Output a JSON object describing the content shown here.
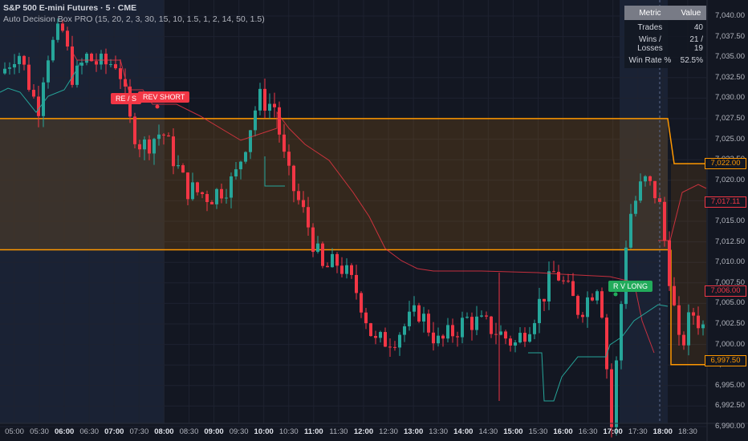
{
  "header": {
    "title": "S&P 500 E-mini Futures · 5 · CME",
    "indicator": "Auto Decision Box PRO (15, 20, 2, 3, 30, 15, 10, 1.5, 1, 2, 14, 50, 1.5)"
  },
  "colors": {
    "background": "#131722",
    "up": "#26a69a",
    "down": "#f23645",
    "box_line": "#ff9800",
    "trail_short": "#f23645",
    "trail_long": "#26a69a",
    "session_shade": "#1a2234"
  },
  "stats_table": {
    "headers": [
      "Metric",
      "Value"
    ],
    "rows": [
      {
        "metric": "Trades",
        "value": "40"
      },
      {
        "metric": "Wins / Losses",
        "value": "21 / 19"
      },
      {
        "metric": "Win Rate %",
        "value": "52.5%"
      }
    ]
  },
  "signals": [
    {
      "label": "RE / S",
      "type": "short"
    },
    {
      "label": "REV SHORT",
      "type": "short"
    },
    {
      "label": "R  V LONG",
      "type": "long"
    }
  ],
  "price_axis": {
    "ticks": [
      "7,040.00",
      "7,037.50",
      "7,035.00",
      "7,032.50",
      "7,030.00",
      "7,027.50",
      "7,025.00",
      "7,022.50",
      "7,020.00",
      "7,017.50",
      "7,015.00",
      "7,012.50",
      "7,010.00",
      "7,007.50",
      "7,005.00",
      "7,002.50",
      "7,000.00",
      "6,997.50",
      "6,995.00",
      "6,992.50",
      "6,990.00"
    ],
    "badges": [
      {
        "label": "7,022.00",
        "color": "#ff9800"
      },
      {
        "label": "7,017.11",
        "color": "#f23645"
      },
      {
        "label": "7,006.00",
        "color": "#f23645"
      },
      {
        "label": "6,997.50",
        "color": "#ff9800"
      }
    ]
  },
  "time_axis": {
    "ticks": [
      {
        "label": "05:00",
        "bold": false
      },
      {
        "label": "05:30",
        "bold": false
      },
      {
        "label": "06:00",
        "bold": true
      },
      {
        "label": "06:30",
        "bold": false
      },
      {
        "label": "07:00",
        "bold": true
      },
      {
        "label": "07:30",
        "bold": false
      },
      {
        "label": "08:00",
        "bold": true
      },
      {
        "label": "08:30",
        "bold": false
      },
      {
        "label": "09:00",
        "bold": true
      },
      {
        "label": "09:30",
        "bold": false
      },
      {
        "label": "10:00",
        "bold": true
      },
      {
        "label": "10:30",
        "bold": false
      },
      {
        "label": "11:00",
        "bold": true
      },
      {
        "label": "11:30",
        "bold": false
      },
      {
        "label": "12:00",
        "bold": true
      },
      {
        "label": "12:30",
        "bold": false
      },
      {
        "label": "13:00",
        "bold": true
      },
      {
        "label": "13:30",
        "bold": false
      },
      {
        "label": "14:00",
        "bold": true
      },
      {
        "label": "14:30",
        "bold": false
      },
      {
        "label": "15:00",
        "bold": true
      },
      {
        "label": "15:30",
        "bold": false
      },
      {
        "label": "16:00",
        "bold": true
      },
      {
        "label": "16:30",
        "bold": false
      },
      {
        "label": "17:00",
        "bold": true
      },
      {
        "label": "17:30",
        "bold": false
      },
      {
        "label": "18:00",
        "bold": true
      },
      {
        "label": "18:30",
        "bold": false
      }
    ]
  },
  "box": {
    "upper": 7027.5,
    "lower": 7011.5,
    "upper_after": 7022.0,
    "lower_after": 6997.5
  }
}
